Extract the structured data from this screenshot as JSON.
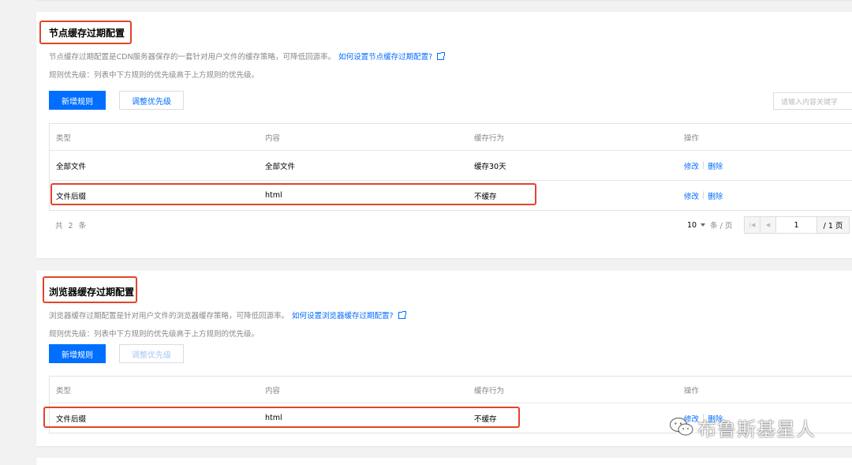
{
  "section1": {
    "title": "节点缓存过期配置",
    "desc": "节点缓存过期配置是CDN服务器保存的一套针对用户文件的缓存策略，可降低回源率。",
    "help_link": "如何设置节点缓存过期配置?",
    "priority_note": "规则优先级：列表中下方规则的优先级高于上方规则的优先级。",
    "add_button": "新增规则",
    "adjust_button": "调整优先级",
    "search_placeholder": "请输入内容关键字",
    "headers": [
      "类型",
      "内容",
      "缓存行为",
      "操作"
    ],
    "rows": [
      {
        "type": "全部文件",
        "content": "全部文件",
        "behavior": "缓存30天",
        "edit": "修改",
        "delete": "删除"
      },
      {
        "type": "文件后缀",
        "content": "html",
        "behavior": "不缓存",
        "edit": "修改",
        "delete": "删除"
      }
    ],
    "total": "共 2 条",
    "page_size": "10",
    "page_size_unit": "条 / 页",
    "current_page": "1",
    "total_pages": "/ 1 页"
  },
  "section2": {
    "title": "浏览器缓存过期配置",
    "desc": "浏览器缓存过期配置是针对用户文件的浏览器缓存策略，可降低回源率。",
    "help_link": "如何设置浏览器缓存过期配置?",
    "priority_note": "规则优先级：列表中下方规则的优先级高于上方规则的优先级。",
    "add_button": "新增规则",
    "adjust_button": "调整优先级",
    "headers": [
      "类型",
      "内容",
      "缓存行为",
      "操作"
    ],
    "rows": [
      {
        "type": "文件后缀",
        "content": "html",
        "behavior": "不缓存",
        "edit": "修改",
        "delete": "删除"
      }
    ]
  },
  "watermark": {
    "text": "布鲁斯基星人",
    "icon": "wechat-icon"
  },
  "colors": {
    "accent": "#006eff",
    "highlight": "#e0452b",
    "page_bg": "#f2f2f2"
  }
}
